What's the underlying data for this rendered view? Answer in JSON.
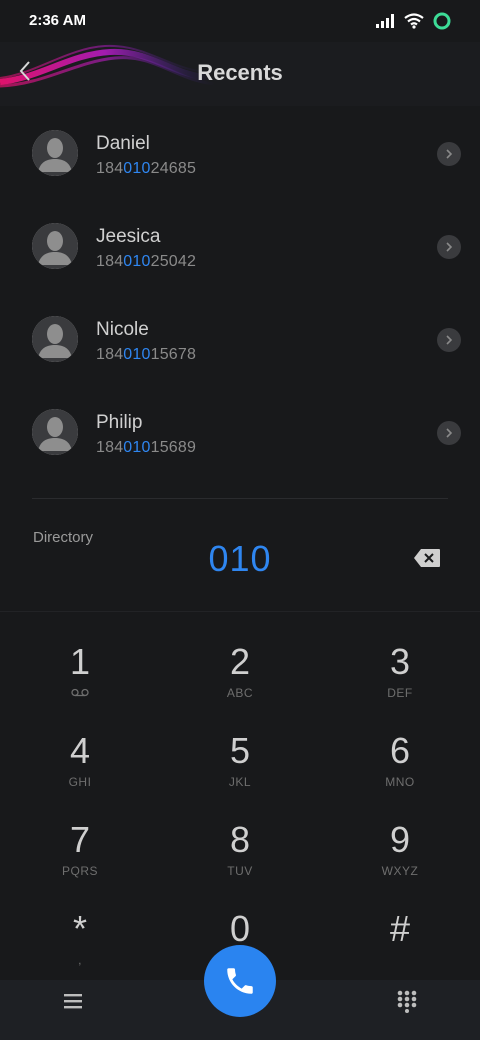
{
  "status_bar": {
    "time": "2:36 AM",
    "icons": [
      "signal-icon",
      "wifi-icon",
      "battery-ring-icon"
    ]
  },
  "header": {
    "title": "Recents",
    "back_icon": "back-arrow-icon"
  },
  "contacts": [
    {
      "name": "Daniel",
      "number_prefix": "184",
      "number_match": "010",
      "number_suffix": "24685"
    },
    {
      "name": "Jeesica",
      "number_prefix": "184",
      "number_match": "010",
      "number_suffix": "25042"
    },
    {
      "name": "Nicole",
      "number_prefix": "184",
      "number_match": "010",
      "number_suffix": "15678"
    },
    {
      "name": "Philip",
      "number_prefix": "184",
      "number_match": "010",
      "number_suffix": "15689"
    }
  ],
  "directory_label": "Directory",
  "dialed_number": "010",
  "keypad": {
    "keys": [
      {
        "digit": "1",
        "letters": ""
      },
      {
        "digit": "2",
        "letters": "ABC"
      },
      {
        "digit": "3",
        "letters": "DEF"
      },
      {
        "digit": "4",
        "letters": "GHI"
      },
      {
        "digit": "5",
        "letters": "JKL"
      },
      {
        "digit": "6",
        "letters": "MNO"
      },
      {
        "digit": "7",
        "letters": "PQRS"
      },
      {
        "digit": "8",
        "letters": "TUV"
      },
      {
        "digit": "9",
        "letters": "WXYZ"
      },
      {
        "digit": "*",
        "letters": ","
      },
      {
        "digit": "0",
        "letters": ""
      },
      {
        "digit": "#",
        "letters": ""
      }
    ]
  },
  "colors": {
    "accent": "#2f86f0",
    "background": "#18191b",
    "call_button": "#2a84f0"
  }
}
